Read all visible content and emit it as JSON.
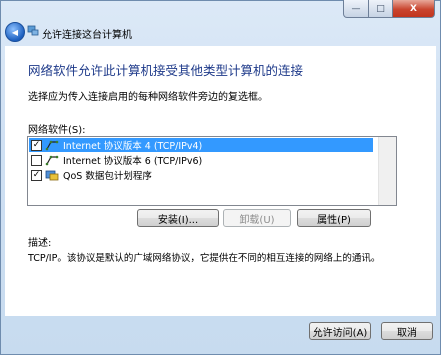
{
  "window": {
    "minimize_icon": "minimize-icon",
    "maximize_icon": "maximize-icon",
    "close_icon": "close-icon",
    "minimize_glyph": "—",
    "maximize_glyph": "□",
    "close_glyph": "X"
  },
  "nav": {
    "back_glyph": "◀",
    "title": "允许连接这台计算机"
  },
  "content": {
    "heading": "网络软件允许此计算机接受其他类型计算机的连接",
    "instruction": "选择应为传入连接启用的每种网络软件旁边的复选框。",
    "network_software_label": "网络软件(S):",
    "items": [
      {
        "label": "Internet 协议版本 4 (TCP/IPv4)",
        "checked": true,
        "selected": true,
        "icon": "network-protocol-icon"
      },
      {
        "label": "Internet 协议版本 6 (TCP/IPv6)",
        "checked": false,
        "selected": false,
        "icon": "network-protocol-icon"
      },
      {
        "label": "QoS 数据包计划程序",
        "checked": true,
        "selected": false,
        "icon": "network-service-icon"
      }
    ],
    "check_glyph": "✓",
    "buttons": {
      "install": "安装(I)...",
      "uninstall": "卸载(U)",
      "properties": "属性(P)"
    },
    "description_label": "描述:",
    "description_text": "TCP/IP。该协议是默认的广域网络协议，它提供在不同的相互连接的网络上的通讯。"
  },
  "footer": {
    "allow_access": "允许访问(A)",
    "cancel": "取消"
  },
  "colors": {
    "heading": "#1e3a8a",
    "selection": "#3399ff"
  }
}
